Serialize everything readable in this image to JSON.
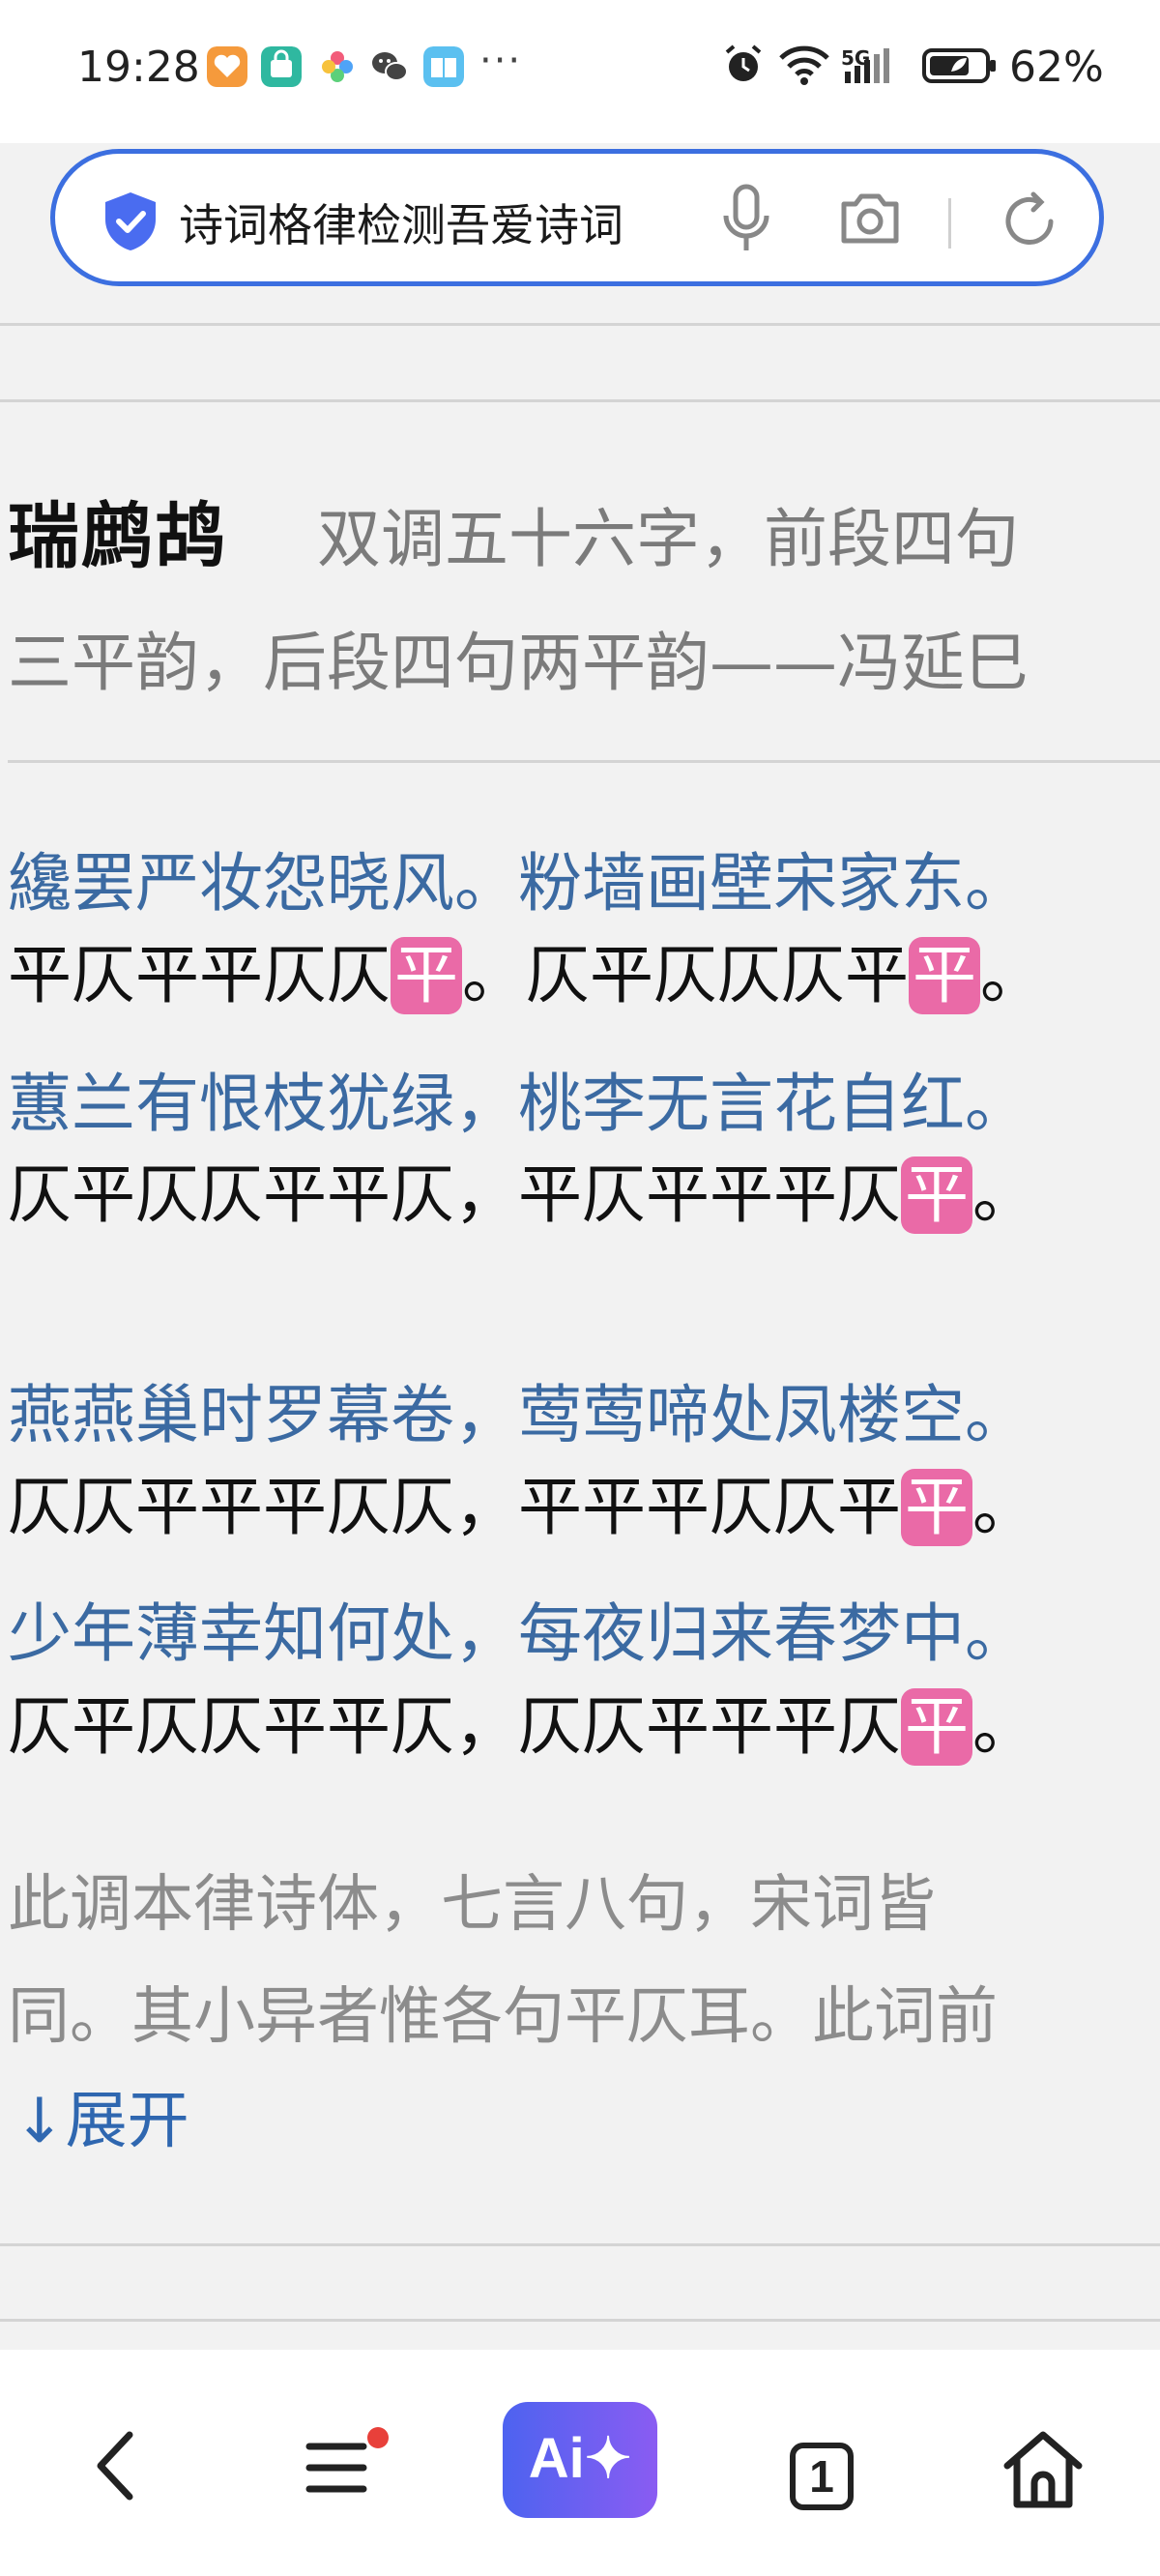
{
  "status_bar": {
    "time": "19:28",
    "more": "···",
    "network": "5G",
    "battery": "62%"
  },
  "search": {
    "query": "诗词格律检测吾爱诗词"
  },
  "article": {
    "title": "瑞鹧鸪",
    "desc_line1": "双调五十六字，前段四句",
    "desc_line2": "三平韵，后段四句两平韵——冯延巳",
    "stanzas": [
      {
        "poem": "纔罢严妆怨晓风。粉墙画壁宋家东。",
        "tones_pre": "平仄平平仄仄",
        "tones_mid": "。仄平仄仄仄平",
        "tones_post": "。"
      },
      {
        "poem": "蕙兰有恨枝犹绿，桃李无言花自红。",
        "tones_pre": "仄平仄仄平平仄，平仄平平平仄",
        "tones_post": "。"
      },
      {
        "poem": "燕燕巢时罗幕卷，莺莺啼处凤楼空。",
        "tones_pre": "仄仄平平平仄仄，平平平仄仄平",
        "tones_post": "。"
      },
      {
        "poem": "少年薄幸知何处，每夜归来春梦中。",
        "tones_pre": "仄平仄仄平平仄，仄仄平平平仄",
        "tones_post": "。"
      }
    ],
    "rhyme_mark": "平",
    "note_line1": "此调本律诗体，七言八句，宋词皆",
    "note_line2": "同。其小异者惟各句平仄耳。此词前",
    "expand_label": "↓展开"
  },
  "bottom_nav": {
    "ai_label": "Ai✦",
    "tab_count": "1"
  },
  "colors": {
    "accent": "#3c6fe0",
    "poem_text": "#3b6aa2",
    "rhyme_highlight": "#ea6aa7",
    "notification_dot": "#e8403a"
  }
}
